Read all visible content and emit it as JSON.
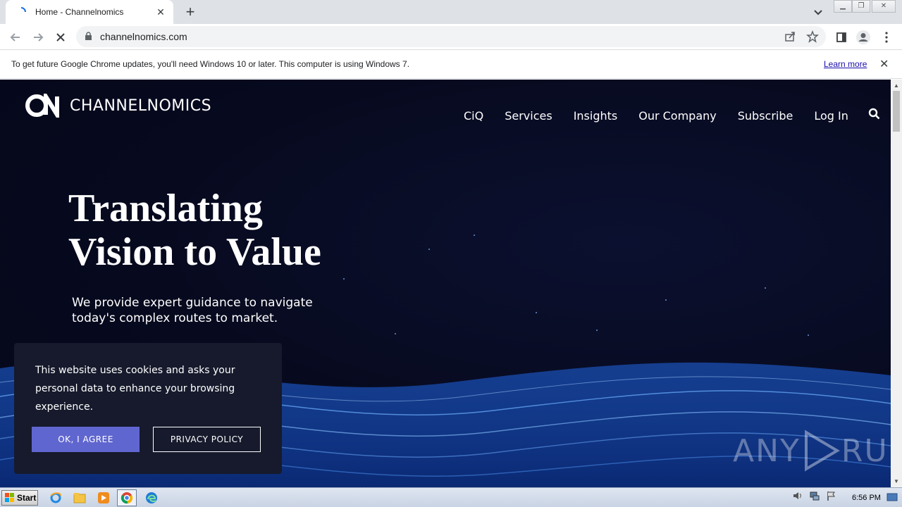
{
  "browser": {
    "tab_title": "Home - Channelnomics",
    "new_tab": "+",
    "url": "channelnomics.com"
  },
  "infobar": {
    "message": "To get future Google Chrome updates, you'll need Windows 10 or later. This computer is using Windows 7.",
    "learn_more": "Learn more"
  },
  "site": {
    "brand": "CHANNELNOMICS",
    "nav": [
      "CiQ",
      "Services",
      "Insights",
      "Our Company",
      "Subscribe",
      "Log In"
    ],
    "hero_title_1": "Translating",
    "hero_title_2": "Vision to Value",
    "hero_subtitle": "We provide expert guidance to navigate today's complex routes to market."
  },
  "cookie": {
    "text": "This website uses cookies and asks your personal data to enhance your browsing experience.",
    "agree": "OK, I AGREE",
    "policy": "PRIVACY POLICY"
  },
  "watermark": {
    "left": "ANY",
    "right": "RUN"
  },
  "taskbar": {
    "start": "Start",
    "clock": "6:56 PM"
  },
  "colors": {
    "page_bg": "#070a1e",
    "agree_button": "#6066cf",
    "cookie_bg": "#161a2c"
  }
}
